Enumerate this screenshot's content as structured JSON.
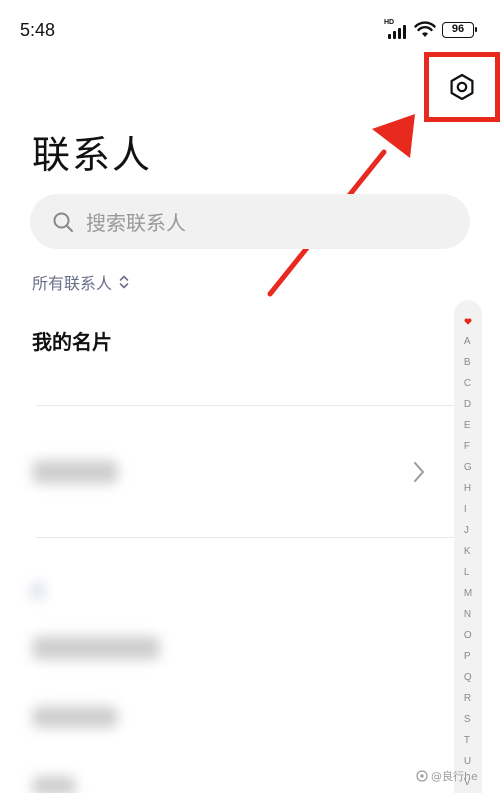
{
  "status_bar": {
    "time": "5:48",
    "network_label": "HD",
    "battery_level": "96",
    "icons": [
      "signal-icon",
      "wifi-icon",
      "battery-icon"
    ]
  },
  "header": {
    "title": "联系人",
    "settings_icon": "settings-hexagon-icon",
    "highlight_color": "#e8291e"
  },
  "search": {
    "placeholder": "搜索联系人"
  },
  "filter": {
    "label": "所有联系人"
  },
  "my_card": {
    "label": "我的名片"
  },
  "alphabet_index": {
    "favorites_icon": "heart-icon",
    "letters": [
      "A",
      "B",
      "C",
      "D",
      "E",
      "F",
      "G",
      "H",
      "I",
      "J",
      "K",
      "L",
      "M",
      "N",
      "O",
      "P",
      "Q",
      "R",
      "S",
      "T",
      "U",
      "V"
    ]
  },
  "watermark": {
    "text": "@良行he"
  },
  "colors": {
    "accent_red": "#e8291e",
    "heart": "#e8291e",
    "filter_text": "#6b6f8a"
  }
}
